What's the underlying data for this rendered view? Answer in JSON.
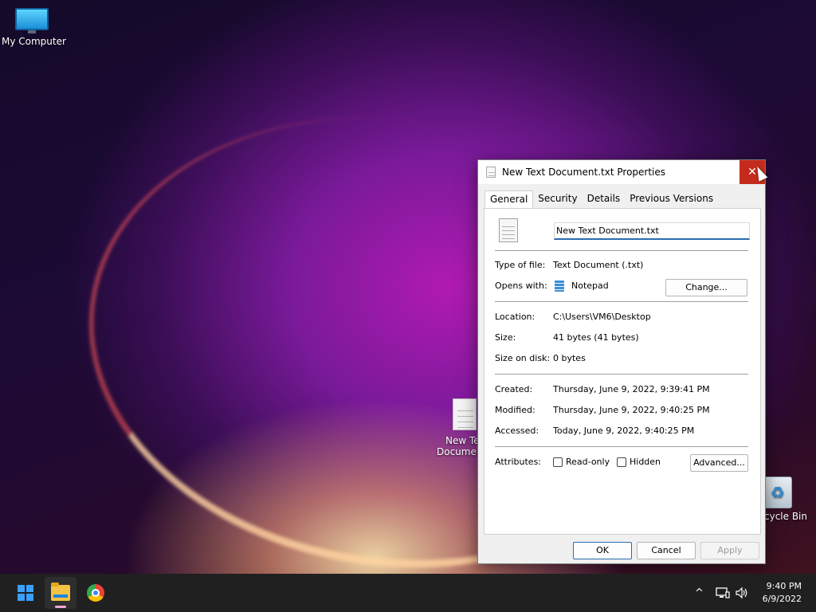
{
  "desktop": {
    "icons": [
      {
        "label": "My Computer"
      },
      {
        "label": "New Text Document"
      },
      {
        "label": "Recycle Bin"
      }
    ],
    "partial_labels": {
      "doc_line1": "New Tex",
      "doc_line2": "Documen",
      "bin": "cycle Bin"
    }
  },
  "dialog": {
    "title": "New Text Document.txt Properties",
    "close_glyph": "✕",
    "tabs": [
      {
        "label": "General",
        "active": true
      },
      {
        "label": "Security",
        "active": false
      },
      {
        "label": "Details",
        "active": false
      },
      {
        "label": "Previous Versions",
        "active": false
      }
    ],
    "file_name": "New Text Document.txt",
    "type_label": "Type of file:",
    "type_value": "Text Document (.txt)",
    "opens_label": "Opens with:",
    "opens_value": "Notepad",
    "change_button": "Change...",
    "location_label": "Location:",
    "location_value": "C:\\Users\\VM6\\Desktop",
    "size_label": "Size:",
    "size_value": "41 bytes (41 bytes)",
    "size_on_disk_label": "Size on disk:",
    "size_on_disk_value": "0 bytes",
    "created_label": "Created:",
    "created_value": "Thursday, June 9, 2022, 9:39:41 PM",
    "modified_label": "Modified:",
    "modified_value": "Thursday, June 9, 2022, 9:40:25 PM",
    "accessed_label": "Accessed:",
    "accessed_value": "Today, June 9, 2022, 9:40:25 PM",
    "attributes_label": "Attributes:",
    "readonly_label": "Read-only",
    "hidden_label": "Hidden",
    "advanced_button": "Advanced...",
    "ok_button": "OK",
    "cancel_button": "Cancel",
    "apply_button": "Apply"
  },
  "taskbar": {
    "time": "9:40 PM",
    "date": "6/9/2022",
    "tray_chevron": "^",
    "accent": "#3aa0ff"
  }
}
